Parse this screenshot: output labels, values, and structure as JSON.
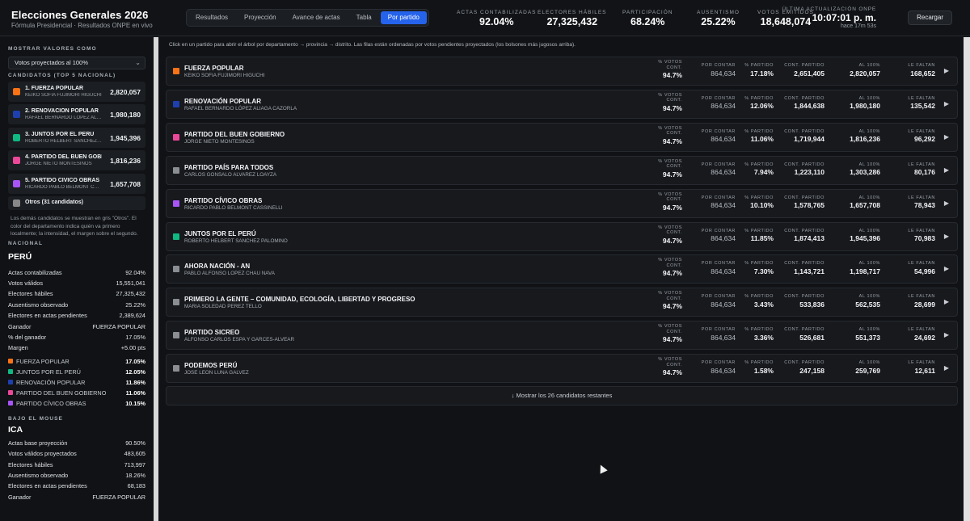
{
  "header": {
    "title": "Elecciones Generales 2026",
    "subtitle": "Fórmula Presidencial · Resultados ONPE en vivo",
    "tabs": [
      "Resultados",
      "Proyección",
      "Avance de actas",
      "Tabla",
      "Por partido"
    ],
    "active_tab": "Por partido",
    "stats": [
      {
        "label": "ACTAS CONTABILIZADAS",
        "value": "92.04%"
      },
      {
        "label": "ELECTORES HÁBILES",
        "value": "27,325,432"
      },
      {
        "label": "PARTICIPACIÓN",
        "value": "68.24%"
      },
      {
        "label": "AUSENTISMO",
        "value": "25.22%"
      },
      {
        "label": "VOTOS EMITIDOS",
        "value": "18,648,074"
      }
    ],
    "update_label": "ÚLTIMA ACTUALIZACIÓN ONPE",
    "update_time": "10:07:01 p. m.",
    "update_ago": "hace 17m 53s",
    "reload_label": "Recargar"
  },
  "sidebar": {
    "show_label": "MOSTRAR VALORES COMO",
    "select_value": "Votos proyectados al 100%",
    "candidates_label": "CANDIDATOS (TOP 5 NACIONAL)",
    "candidates": [
      {
        "name": "1. FUERZA POPULAR",
        "sub": "KEIKO SOFIA FUJIMORI HIGUCHI",
        "value": "2,820,057",
        "color": "#f97316"
      },
      {
        "name": "2. RENOVACIÓN POPULAR",
        "sub": "RAFAEL BERNARDO LÓPEZ ALIAGA CAZORLA",
        "value": "1,980,180",
        "color": "#1e40af"
      },
      {
        "name": "3. JUNTOS POR EL PERÚ",
        "sub": "ROBERTO HELBERT SANCHEZ PALOMINO",
        "value": "1,945,396",
        "color": "#10b981"
      },
      {
        "name": "4. PARTIDO DEL BUEN GOBIERNO",
        "sub": "JORGE NIETO MONTESINOS",
        "value": "1,816,236",
        "color": "#ec4899"
      },
      {
        "name": "5. PARTIDO CÍVICO OBRAS",
        "sub": "RICARDO PABLO BELMONT CASSINELLI",
        "value": "1,657,708",
        "color": "#a855f7"
      }
    ],
    "others": "Otros (31 candidatos)",
    "note": "Los demás candidatos se muestran en gris \"Otros\". El color del departamento indica quién va primero localmente; la intensidad, el margen sobre el segundo.",
    "national_label": "NACIONAL",
    "national_title": "PERÚ",
    "national_rows": [
      {
        "k": "Actas contabilizadas",
        "v": "92.04%"
      },
      {
        "k": "Votos válidos",
        "v": "15,551,041"
      },
      {
        "k": "Electores hábiles",
        "v": "27,325,432"
      },
      {
        "k": "Ausentismo observado",
        "v": "25.22%"
      },
      {
        "k": "Electores en actas pendientes",
        "v": "2,389,624"
      },
      {
        "k": "Ganador",
        "v": "FUERZA POPULAR"
      },
      {
        "k": "% del ganador",
        "v": "17.05%"
      },
      {
        "k": "Margen",
        "v": "+5.00 pts"
      }
    ],
    "national_legend": [
      {
        "name": "FUERZA POPULAR",
        "v": "17.05%",
        "color": "#f97316"
      },
      {
        "name": "JUNTOS POR EL PERÚ",
        "v": "12.05%",
        "color": "#10b981"
      },
      {
        "name": "RENOVACIÓN POPULAR",
        "v": "11.86%",
        "color": "#1e40af"
      },
      {
        "name": "PARTIDO DEL BUEN GOBIERNO",
        "v": "11.06%",
        "color": "#ec4899"
      },
      {
        "name": "PARTIDO CÍVICO OBRAS",
        "v": "10.15%",
        "color": "#a855f7"
      }
    ],
    "hover_label": "BAJO EL MOUSE",
    "hover_title": "ICA",
    "hover_rows": [
      {
        "k": "Actas base proyección",
        "v": "90.50%"
      },
      {
        "k": "Votos válidos proyectados",
        "v": "483,605"
      },
      {
        "k": "Electores hábiles",
        "v": "713,997"
      },
      {
        "k": "Ausentismo observado",
        "v": "18.26%"
      },
      {
        "k": "Electores en actas pendientes",
        "v": "68,183"
      },
      {
        "k": "Ganador",
        "v": "FUERZA POPULAR"
      }
    ]
  },
  "main": {
    "hint": "Click en un partido para abrir el árbol por departamento → provincia → distrito. Las filas están ordenadas por votos pendientes proyectados (los bolsones más jugosos arriba).",
    "metric_labels": {
      "pct_cont": "% VOTOS CONT.",
      "por_contar": "POR CONTAR",
      "pct_partido": "% PARTIDO",
      "cont_partido": "CONT. PARTIDO",
      "al_100": "AL 100%",
      "le_faltan": "LE FALTAN"
    },
    "rows": [
      {
        "name": "FUERZA POPULAR",
        "cand": "KEIKO SOFIA FUJIMORI HIGUCHI",
        "color": "#f97316",
        "pct_cont": "94.7%",
        "por_contar": "864,634",
        "pct_partido": "17.18%",
        "cont_partido": "2,651,405",
        "al_100": "2,820,057",
        "le_faltan": "168,652"
      },
      {
        "name": "RENOVACIÓN POPULAR",
        "cand": "RAFAEL BERNARDO LÓPEZ ALIAGA CAZORLA",
        "color": "#1e40af",
        "pct_cont": "94.7%",
        "por_contar": "864,634",
        "pct_partido": "12.06%",
        "cont_partido": "1,844,638",
        "al_100": "1,980,180",
        "le_faltan": "135,542"
      },
      {
        "name": "PARTIDO DEL BUEN GOBIERNO",
        "cand": "JORGE NIETO MONTESINOS",
        "color": "#ec4899",
        "pct_cont": "94.7%",
        "por_contar": "864,634",
        "pct_partido": "11.06%",
        "cont_partido": "1,719,944",
        "al_100": "1,816,236",
        "le_faltan": "96,292"
      },
      {
        "name": "PARTIDO PAÍS PARA TODOS",
        "cand": "CARLOS GONSALO ALVAREZ LOAYZA",
        "color": "#8a8d92",
        "pct_cont": "94.7%",
        "por_contar": "864,634",
        "pct_partido": "7.94%",
        "cont_partido": "1,223,110",
        "al_100": "1,303,286",
        "le_faltan": "80,176"
      },
      {
        "name": "PARTIDO CÍVICO OBRAS",
        "cand": "RICARDO PABLO BELMONT CASSINELLI",
        "color": "#a855f7",
        "pct_cont": "94.7%",
        "por_contar": "864,634",
        "pct_partido": "10.10%",
        "cont_partido": "1,578,765",
        "al_100": "1,657,708",
        "le_faltan": "78,943"
      },
      {
        "name": "JUNTOS POR EL PERÚ",
        "cand": "ROBERTO HELBERT SANCHEZ PALOMINO",
        "color": "#10b981",
        "pct_cont": "94.7%",
        "por_contar": "864,634",
        "pct_partido": "11.85%",
        "cont_partido": "1,874,413",
        "al_100": "1,945,396",
        "le_faltan": "70,983"
      },
      {
        "name": "AHORA NACIÓN - AN",
        "cand": "PABLO ALFONSO LOPEZ CHAU NAVA",
        "color": "#8a8d92",
        "pct_cont": "94.7%",
        "por_contar": "864,634",
        "pct_partido": "7.30%",
        "cont_partido": "1,143,721",
        "al_100": "1,198,717",
        "le_faltan": "54,996"
      },
      {
        "name": "PRIMERO LA GENTE – COMUNIDAD, ECOLOGÍA, LIBERTAD Y PROGRESO",
        "cand": "MARIA SOLEDAD PEREZ TELLO",
        "color": "#8a8d92",
        "pct_cont": "94.7%",
        "por_contar": "864,634",
        "pct_partido": "3.43%",
        "cont_partido": "533,836",
        "al_100": "562,535",
        "le_faltan": "28,699"
      },
      {
        "name": "PARTIDO SICREO",
        "cand": "ALFONSO CARLOS ESPA Y GARCES-ALVEAR",
        "color": "#8a8d92",
        "pct_cont": "94.7%",
        "por_contar": "864,634",
        "pct_partido": "3.36%",
        "cont_partido": "526,681",
        "al_100": "551,373",
        "le_faltan": "24,692"
      },
      {
        "name": "PODEMOS PERÚ",
        "cand": "JOSE LEON LUNA GALVEZ",
        "color": "#8a8d92",
        "pct_cont": "94.7%",
        "por_contar": "864,634",
        "pct_partido": "1.58%",
        "cont_partido": "247,158",
        "al_100": "259,769",
        "le_faltan": "12,611"
      }
    ],
    "show_more": "↓ Mostrar los 26 candidatos restantes",
    "play_icon": "▶"
  }
}
